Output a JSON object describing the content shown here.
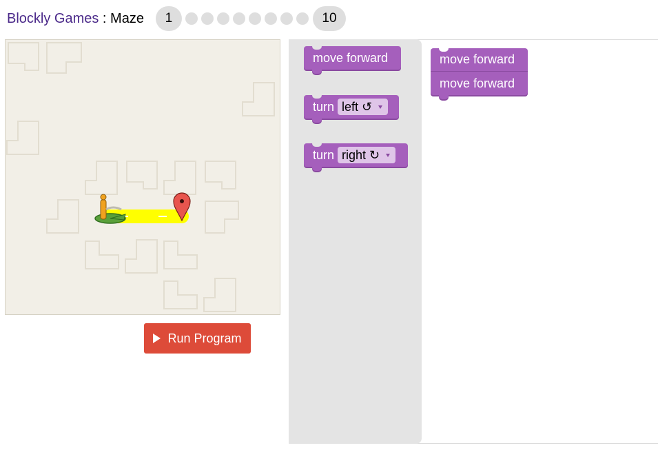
{
  "header": {
    "app_link": "Blockly Games",
    "separator": " : ",
    "game_name": "Maze",
    "levels": {
      "current": "1",
      "last": "10",
      "dot_count": 8
    }
  },
  "run_button": {
    "label": "Run Program",
    "icon": "play-icon"
  },
  "toolbox": {
    "blocks": [
      {
        "label": "move forward"
      },
      {
        "label": "turn",
        "dropdown": "left ↺"
      },
      {
        "label": "turn",
        "dropdown": "right ↻"
      }
    ]
  },
  "workspace": {
    "blocks": [
      {
        "label": "move forward"
      },
      {
        "label": "move forward"
      }
    ]
  },
  "maze": {
    "path_color": "#ffff00",
    "start_icon": "pegman-icon",
    "goal_icon": "map-marker-icon",
    "goal_color": "#e8554e"
  },
  "colors": {
    "block": "#a55fbc",
    "run_button": "#dd4b39",
    "link": "#4b2a8a"
  }
}
